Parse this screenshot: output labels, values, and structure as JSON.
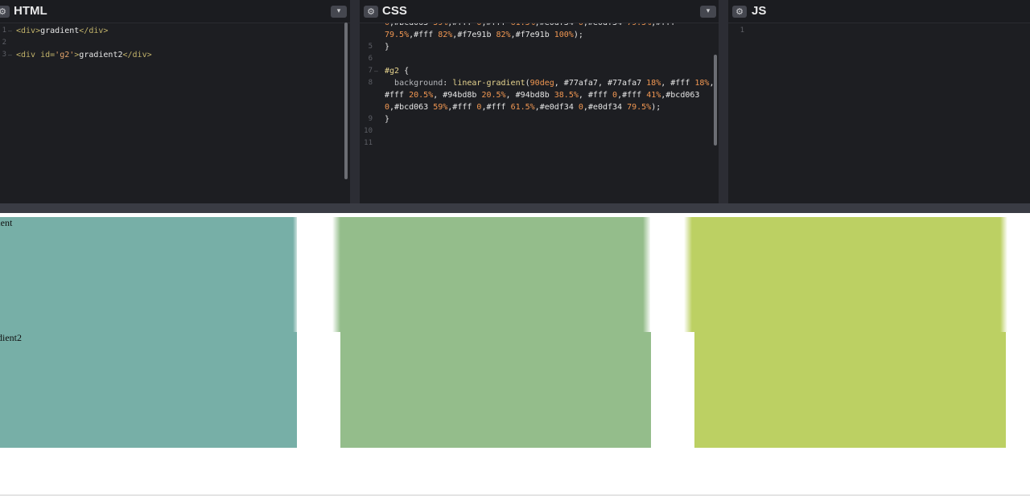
{
  "editors": {
    "html": {
      "title": "HTML",
      "gear_symbol": "⚙",
      "dropdown_symbol": "▾",
      "lines": [
        {
          "num": "1",
          "fold": "–",
          "parts": [
            [
              "tag",
              "<div>"
            ],
            [
              "txt",
              "gradient"
            ],
            [
              "tag",
              "</div>"
            ]
          ]
        },
        {
          "num": "2",
          "fold": "",
          "parts": []
        },
        {
          "num": "3",
          "fold": "–",
          "parts": [
            [
              "tag",
              "<div id="
            ],
            [
              "str",
              "'g2'"
            ],
            [
              "tag",
              ">"
            ],
            [
              "txt",
              "gradient2"
            ],
            [
              "tag",
              "</div>"
            ]
          ]
        }
      ]
    },
    "css": {
      "title": "CSS",
      "gear_symbol": "⚙",
      "dropdown_symbol": "▾",
      "lines": [
        {
          "num": "",
          "fold": "",
          "parts": [
            [
              "num-v",
              "0"
            ],
            [
              "punc",
              ",#bcd063 "
            ],
            [
              "num-v",
              "59%"
            ],
            [
              "punc",
              ",#fff "
            ],
            [
              "num-v",
              "0"
            ],
            [
              "punc",
              ",#fff "
            ],
            [
              "num-v",
              "61.5%"
            ],
            [
              "punc",
              ",#e0df34 "
            ],
            [
              "num-v",
              "0"
            ],
            [
              "punc",
              ",#e0df34 "
            ],
            [
              "num-v",
              "79.5%"
            ],
            [
              "punc",
              ",#fff"
            ]
          ]
        },
        {
          "num": "",
          "fold": "",
          "parts": [
            [
              "num-v",
              "79.5%"
            ],
            [
              "punc",
              ",#fff "
            ],
            [
              "num-v",
              "82%"
            ],
            [
              "punc",
              ",#f7e91b "
            ],
            [
              "num-v",
              "82%"
            ],
            [
              "punc",
              ",#f7e91b "
            ],
            [
              "num-v",
              "100%"
            ],
            [
              "punc",
              ");"
            ]
          ]
        },
        {
          "num": "5",
          "fold": "",
          "parts": [
            [
              "punc",
              "}"
            ]
          ]
        },
        {
          "num": "6",
          "fold": "",
          "parts": []
        },
        {
          "num": "7",
          "fold": "–",
          "parts": [
            [
              "sel",
              "#g2 "
            ],
            [
              "punc",
              "{"
            ]
          ]
        },
        {
          "num": "8",
          "fold": "",
          "parts": [
            [
              "punc",
              "  "
            ],
            [
              "prop",
              "background"
            ],
            [
              "punc",
              ": "
            ],
            [
              "fn",
              "linear-gradient"
            ],
            [
              "punc",
              "("
            ],
            [
              "num-v",
              "90deg"
            ],
            [
              "punc",
              ", #77afa7, #77afa7 "
            ],
            [
              "num-v",
              "18%"
            ],
            [
              "punc",
              ", #fff "
            ],
            [
              "num-v",
              "18%"
            ],
            [
              "punc",
              ","
            ]
          ]
        },
        {
          "num": "",
          "fold": "",
          "parts": [
            [
              "punc",
              "#fff "
            ],
            [
              "num-v",
              "20.5%"
            ],
            [
              "punc",
              ", #94bd8b "
            ],
            [
              "num-v",
              "20.5%"
            ],
            [
              "punc",
              ", #94bd8b "
            ],
            [
              "num-v",
              "38.5%"
            ],
            [
              "punc",
              ", #fff "
            ],
            [
              "num-v",
              "0"
            ],
            [
              "punc",
              ",#fff "
            ],
            [
              "num-v",
              "41%"
            ],
            [
              "punc",
              ",#bcd063"
            ]
          ]
        },
        {
          "num": "",
          "fold": "",
          "parts": [
            [
              "num-v",
              "0"
            ],
            [
              "punc",
              ",#bcd063 "
            ],
            [
              "num-v",
              "59%"
            ],
            [
              "punc",
              ",#fff "
            ],
            [
              "num-v",
              "0"
            ],
            [
              "punc",
              ",#fff "
            ],
            [
              "num-v",
              "61.5%"
            ],
            [
              "punc",
              ",#e0df34 "
            ],
            [
              "num-v",
              "0"
            ],
            [
              "punc",
              ",#e0df34 "
            ],
            [
              "num-v",
              "79.5%"
            ],
            [
              "punc",
              ");"
            ]
          ]
        },
        {
          "num": "9",
          "fold": "",
          "parts": [
            [
              "punc",
              "}"
            ]
          ]
        },
        {
          "num": "10",
          "fold": "",
          "parts": []
        },
        {
          "num": "11",
          "fold": "",
          "parts": []
        }
      ]
    },
    "js": {
      "title": "JS",
      "gear_symbol": "⚙",
      "lines": [
        {
          "num": "1",
          "fold": "",
          "parts": []
        }
      ]
    }
  },
  "preview": {
    "row1_label": "lient",
    "row2_label": "dient2",
    "colors": {
      "teal": "#77afa7",
      "green": "#94bd8b",
      "yellow_green": "#bcd063"
    }
  }
}
